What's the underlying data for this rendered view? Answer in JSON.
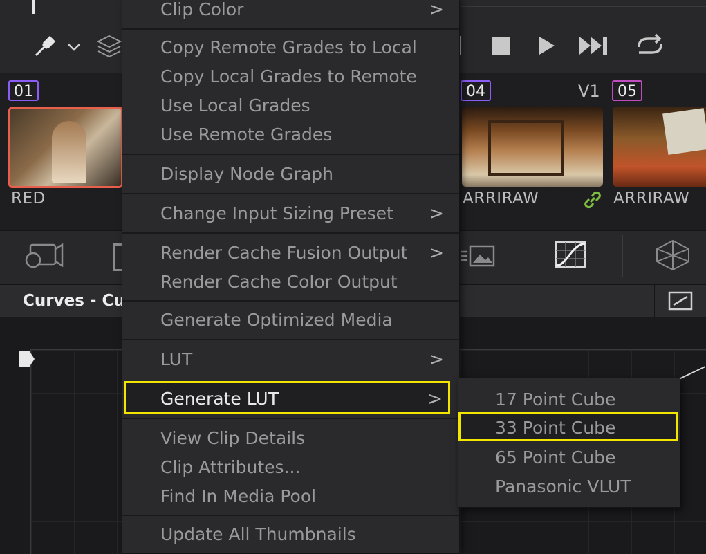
{
  "menu": {
    "items": [
      {
        "label": "Clip Color",
        "submenu": true
      },
      {
        "label": "Copy Remote Grades to Local"
      },
      {
        "label": "Copy Local Grades to Remote"
      },
      {
        "label": "Use Local Grades"
      },
      {
        "label": "Use Remote Grades"
      },
      {
        "label": "Display Node Graph"
      },
      {
        "label": "Change Input Sizing Preset",
        "submenu": true
      },
      {
        "label": "Render Cache Fusion Output",
        "submenu": true
      },
      {
        "label": "Render Cache Color Output"
      },
      {
        "label": "Generate Optimized Media"
      },
      {
        "label": "LUT",
        "submenu": true
      },
      {
        "label": "Generate LUT",
        "submenu": true,
        "highlighted": true
      },
      {
        "label": "View Clip Details"
      },
      {
        "label": "Clip Attributes..."
      },
      {
        "label": "Find In Media Pool"
      },
      {
        "label": "Update All Thumbnails"
      }
    ],
    "chevron": ">"
  },
  "submenu": {
    "items": [
      {
        "label": "17 Point Cube"
      },
      {
        "label": "33 Point Cube",
        "highlighted": true
      },
      {
        "label": "65 Point Cube"
      },
      {
        "label": "Panasonic VLUT"
      }
    ]
  },
  "clips": [
    {
      "number": "01",
      "codec": "RED",
      "badge_color": "#8b5cf6"
    },
    {
      "number": "04",
      "codec": "ARRIRAW",
      "badge_color": "#8b5cf6",
      "track": "V1"
    },
    {
      "number": "05",
      "codec": "ARRIRAW",
      "badge_color": "#c04dc0"
    }
  ],
  "curves": {
    "title": "Curves - Cu"
  },
  "colors": {
    "highlight": "#f2e600",
    "selected_clip_border": "#e8604c",
    "link": "#7fbf3f"
  }
}
